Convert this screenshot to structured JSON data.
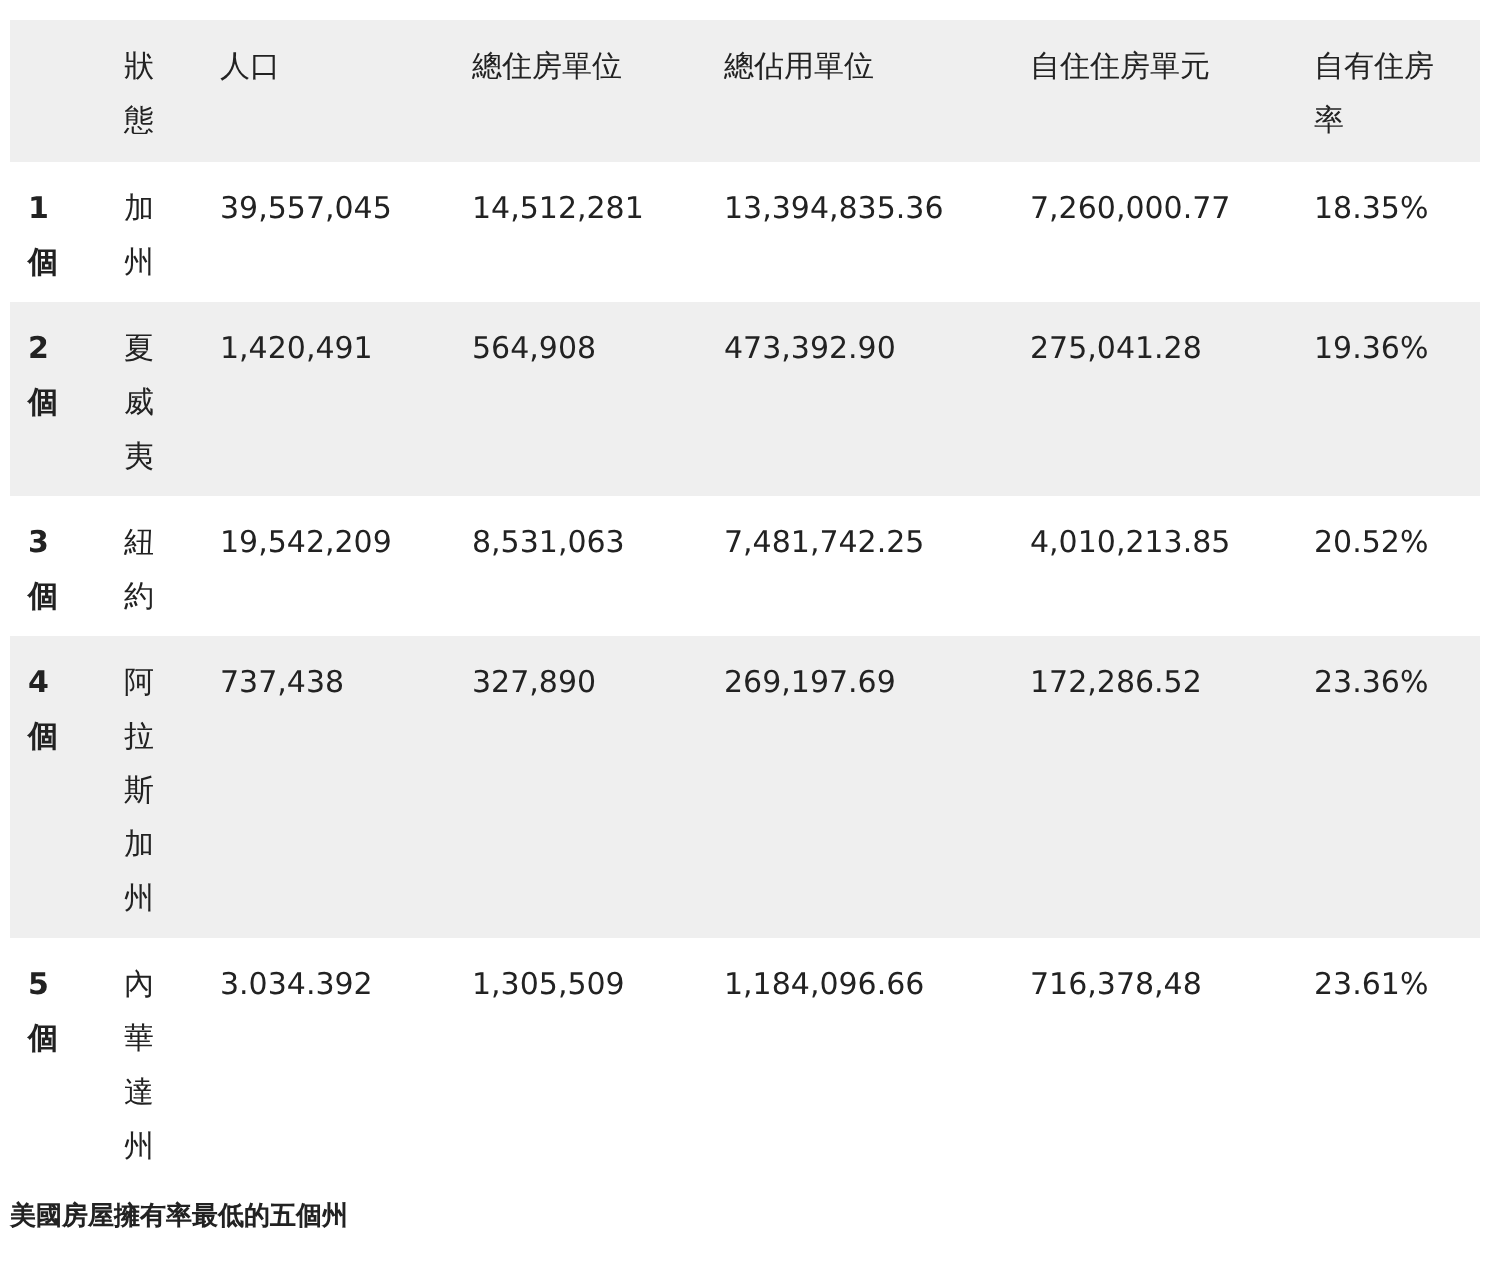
{
  "table": {
    "columns": [
      "狀態",
      "人口",
      "總住房單位",
      "總佔用單位",
      "自住住房單元",
      "自有住房率"
    ],
    "rows": [
      {
        "rank": "1個",
        "cells": [
          "加州",
          "39,557,045",
          "14,512,281",
          "13,394,835.36",
          "7,260,000.77",
          "18.35%"
        ]
      },
      {
        "rank": "2個",
        "cells": [
          "夏威夷",
          "1,420,491",
          "564,908",
          "473,392.90",
          "275,041.28",
          "19.36%"
        ]
      },
      {
        "rank": "3個",
        "cells": [
          "紐約",
          "19,542,209",
          "8,531,063",
          "7,481,742.25",
          "4,010,213.85",
          "20.52%"
        ]
      },
      {
        "rank": "4個",
        "cells": [
          "阿拉斯加州",
          "737,438",
          "327,890",
          "269,197.69",
          "172,286.52",
          "23.36%"
        ]
      },
      {
        "rank": "5個",
        "cells": [
          "內華達州",
          "3.034.392",
          "1,305,509",
          "1,184,096.66",
          "716,378,48",
          "23.61%"
        ]
      }
    ]
  },
  "caption": "美國房屋擁有率最低的五個州"
}
